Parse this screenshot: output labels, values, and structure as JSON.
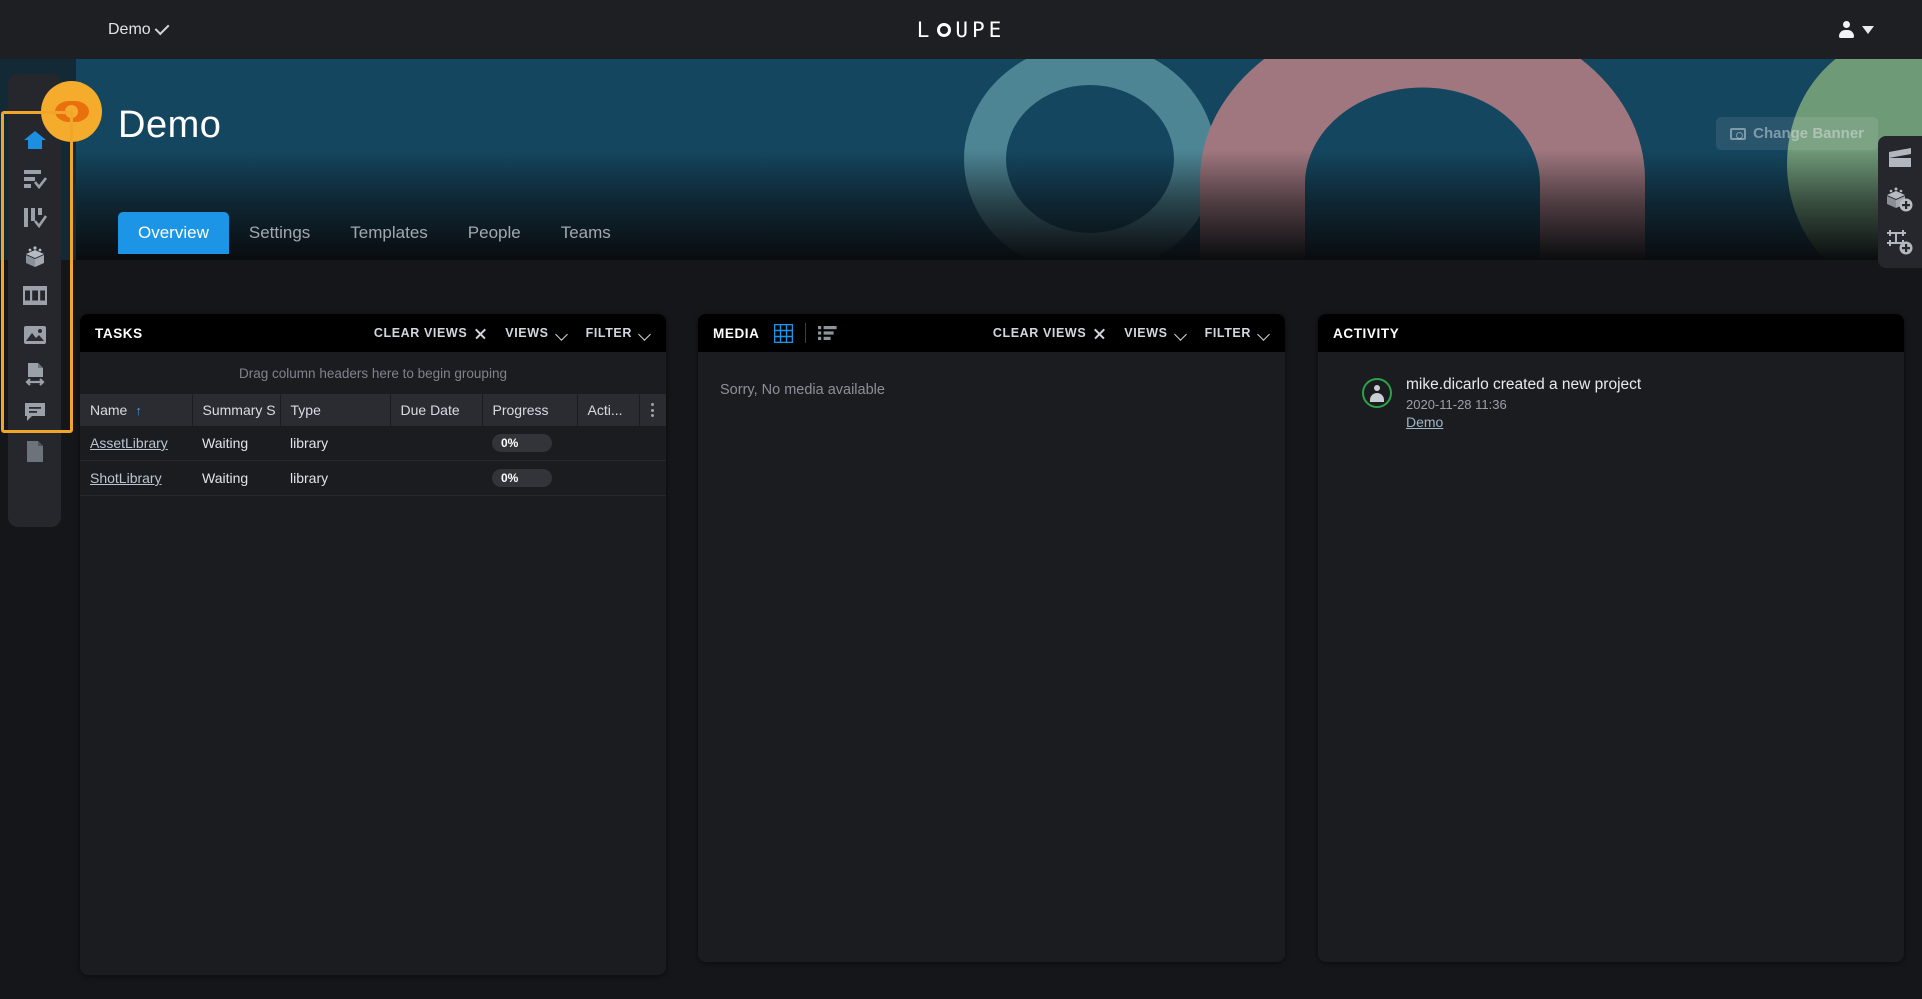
{
  "topbar": {
    "project_label": "Demo",
    "logo_text_left": "L",
    "logo_text_right": "UPE",
    "user_icon": "user-icon",
    "caret_icon": "chevron-down-icon"
  },
  "hero": {
    "change_banner_label": "Change Banner",
    "camera_icon": "camera-icon",
    "colors": {
      "background": "#14465f",
      "teal_ring": "#4d8595",
      "pink_arch": "#a0777f",
      "green_blob": "#6f9a78"
    }
  },
  "page": {
    "title": "Demo",
    "eye_badge_icon": "eye-icon",
    "accent": "#1c95e6",
    "highlight": "#f2a629"
  },
  "tabs": [
    {
      "label": "Overview",
      "active": true
    },
    {
      "label": "Settings",
      "active": false
    },
    {
      "label": "Templates",
      "active": false
    },
    {
      "label": "People",
      "active": false
    },
    {
      "label": "Teams",
      "active": false
    }
  ],
  "sidebar": {
    "items": [
      {
        "name": "home",
        "icon": "home-icon",
        "active": true
      },
      {
        "name": "tasks",
        "icon": "task-list-icon",
        "active": false
      },
      {
        "name": "kanban",
        "icon": "kanban-check-icon",
        "active": false
      },
      {
        "name": "assets",
        "icon": "cube-icon",
        "active": false
      },
      {
        "name": "sequences",
        "icon": "film-strip-icon",
        "active": false
      },
      {
        "name": "media",
        "icon": "image-icon",
        "active": false
      },
      {
        "name": "transfers",
        "icon": "file-transfer-icon",
        "active": false
      },
      {
        "name": "notes",
        "icon": "comment-icon",
        "active": false
      },
      {
        "name": "documents",
        "icon": "document-icon",
        "active": false
      }
    ]
  },
  "right_tools": [
    {
      "name": "add-shot",
      "icon": "clapperboard-icon"
    },
    {
      "name": "add-asset",
      "icon": "cube-plus-icon"
    },
    {
      "name": "add-sequence",
      "icon": "sequence-plus-icon"
    }
  ],
  "tasks_panel": {
    "title": "TASKS",
    "clear_views_label": "CLEAR VIEWS",
    "views_label": "VIEWS",
    "filter_label": "FILTER",
    "grouping_hint": "Drag column headers here to begin grouping",
    "columns": [
      "Name",
      "Summary S",
      "Type",
      "Due Date",
      "Progress",
      "Acti..."
    ],
    "sort_column": "Name",
    "sort_direction": "↑",
    "rows": [
      {
        "name": "AssetLibrary",
        "summary_status": "Waiting",
        "type": "library",
        "due_date": "",
        "progress": "0%",
        "action": ""
      },
      {
        "name": "ShotLibrary",
        "summary_status": "Waiting",
        "type": "library",
        "due_date": "",
        "progress": "0%",
        "action": ""
      }
    ]
  },
  "media_panel": {
    "title": "MEDIA",
    "grid_view_icon": "grid-view-icon",
    "list_view_icon": "list-view-icon",
    "active_view": "grid",
    "clear_views_label": "CLEAR VIEWS",
    "views_label": "VIEWS",
    "filter_label": "FILTER",
    "empty_message": "Sorry, No media available"
  },
  "activity_panel": {
    "title": "ACTIVITY",
    "entries": [
      {
        "text": "mike.dicarlo created a new project",
        "timestamp": "2020-11-28 11:36",
        "link": "Demo"
      }
    ]
  }
}
